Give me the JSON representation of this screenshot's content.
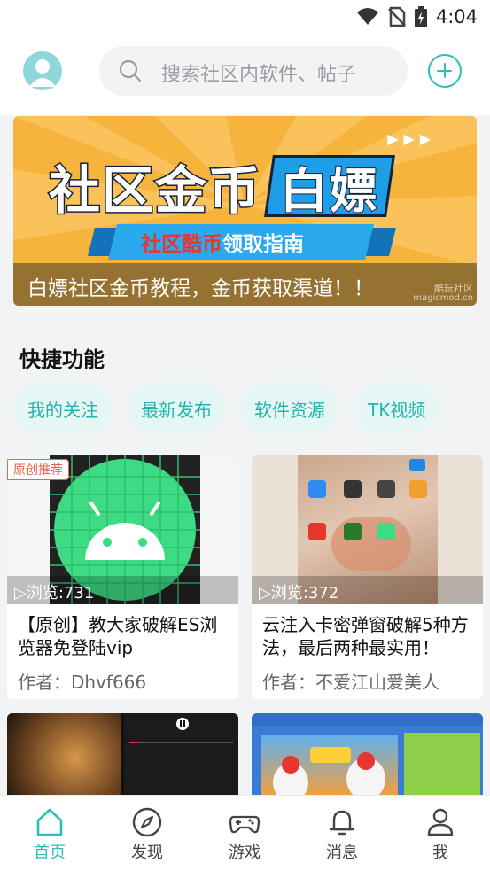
{
  "status_bar": {
    "time": "4:04"
  },
  "search": {
    "placeholder": "搜索社区内软件、帖子"
  },
  "banner": {
    "title_part1": "社区金币",
    "title_part2": "白嫖",
    "ribbon_red": "社区酷币",
    "ribbon_white": "领取指南",
    "caption": "白嫖社区金币教程，金币获取渠道！！",
    "watermark_cn": "酷玩社区",
    "watermark_en": "magicmod.cn"
  },
  "quick": {
    "title": "快捷功能",
    "chips": [
      "我的关注",
      "最新发布",
      "软件资源",
      "TK视频"
    ]
  },
  "cards": [
    {
      "tag": "原创推荐",
      "views": "▷浏览:731",
      "title": "【原创】教大家破解ES浏览器免登陆vip",
      "author": "作者：Dhvf666"
    },
    {
      "views": "▷浏览:372",
      "title": "云注入卡密弹窗破解5种方法，最后两种最实用！",
      "author": "作者：不爱江山爱美人"
    }
  ],
  "tabs": [
    {
      "label": "首页",
      "icon": "home-icon",
      "active": true
    },
    {
      "label": "发现",
      "icon": "compass-icon"
    },
    {
      "label": "游戏",
      "icon": "gamepad-icon"
    },
    {
      "label": "消息",
      "icon": "bell-icon"
    },
    {
      "label": "我",
      "icon": "person-icon"
    }
  ],
  "colors": {
    "accent": "#2bbfb8",
    "tag": "#e8664f",
    "banner_bg": "#f7b43c",
    "banner_blue": "#1f9ee8"
  }
}
